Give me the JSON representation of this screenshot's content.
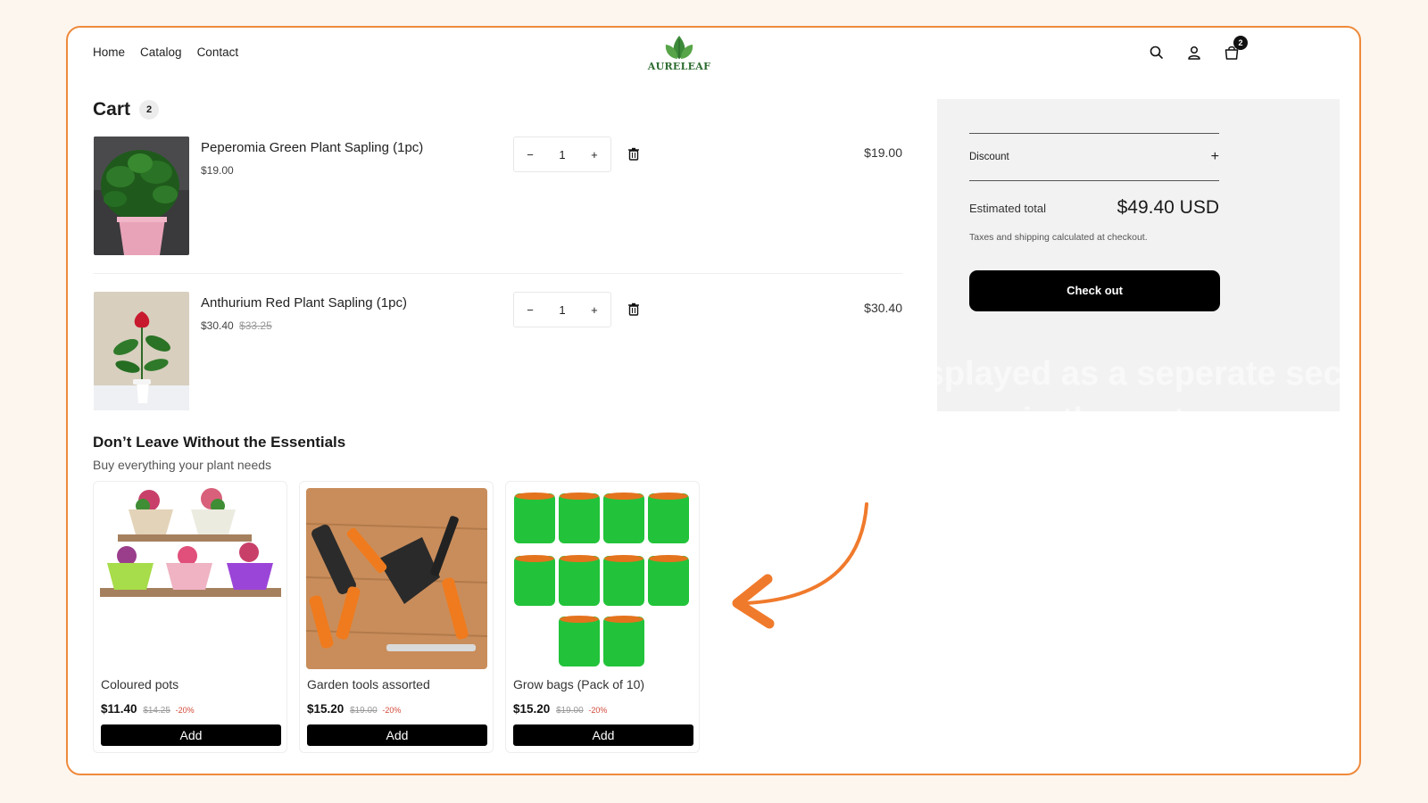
{
  "nav": {
    "items": [
      "Home",
      "Catalog",
      "Contact"
    ]
  },
  "brand": {
    "name": "AURELEAF",
    "accent": "#2c6b2f"
  },
  "header_icons": [
    "search-icon",
    "user-icon",
    "cart-icon"
  ],
  "cart_badge": "2",
  "cart": {
    "title": "Cart",
    "count": "2",
    "items": [
      {
        "name": "Peperomia Green Plant Sapling (1pc)",
        "price": "$19.00",
        "compare_price": "",
        "qty": "1",
        "line_total": "$19.00"
      },
      {
        "name": "Anthurium Red Plant Sapling (1pc)",
        "price": "$30.40",
        "compare_price": "$33.25",
        "qty": "1",
        "line_total": "$30.40"
      }
    ]
  },
  "summary": {
    "discount_label": "Discount",
    "estimated_label": "Estimated total",
    "estimated_value": "$49.40 USD",
    "tax_note": "Taxes and shipping calculated at checkout.",
    "checkout_label": "Check out"
  },
  "ghost_caption": {
    "line1": "Displayed as a seperate section",
    "line2": "in the cart page"
  },
  "essentials": {
    "title": "Don’t Leave Without the Essentials",
    "subtitle": "Buy everything your plant needs",
    "products": [
      {
        "name": "Coloured pots",
        "price": "$11.40",
        "compare_price": "$14.25",
        "discount": "-20%",
        "button": "Add"
      },
      {
        "name": "Garden tools assorted",
        "price": "$15.20",
        "compare_price": "$19.00",
        "discount": "-20%",
        "button": "Add"
      },
      {
        "name": "Grow bags (Pack of 10)",
        "price": "$15.20",
        "compare_price": "$19.00",
        "discount": "-20%",
        "button": "Add"
      }
    ]
  },
  "colors": {
    "frame_border": "#ee8a3c",
    "arrow": "#f07a2c",
    "checkout_bg": "#000000",
    "sale_red": "#d24a3a"
  }
}
